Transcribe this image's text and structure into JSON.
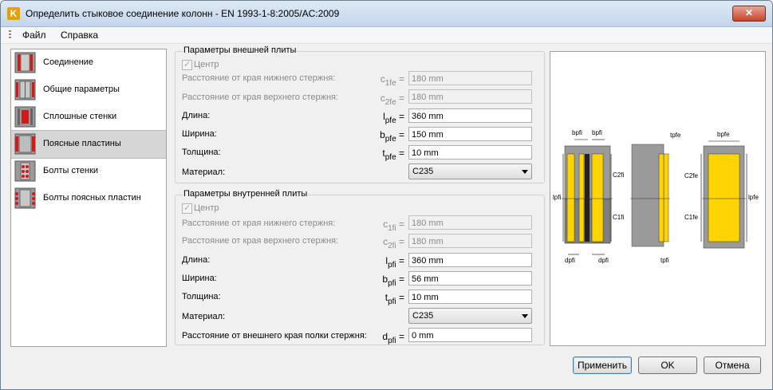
{
  "window": {
    "title": "Определить стыковое соединение колонн - EN 1993-1-8:2005/AC:2009",
    "close": "✕",
    "app_icon": "K"
  },
  "menu": [
    "Файл",
    "Справка"
  ],
  "nav": [
    {
      "label": "Соединение",
      "icon": "connection-icon"
    },
    {
      "label": "Общие параметры",
      "icon": "general-params-icon"
    },
    {
      "label": "Сплошные стенки",
      "icon": "solid-web-icon"
    },
    {
      "label": "Поясные пластины",
      "icon": "flange-plates-icon"
    },
    {
      "label": "Болты стенки",
      "icon": "web-bolts-icon"
    },
    {
      "label": "Болты поясных пластин",
      "icon": "flange-plate-bolts-icon"
    }
  ],
  "outer": {
    "title": "Параметры внешней плиты",
    "center": "Центр",
    "rows": [
      {
        "label": "Расстояние от края нижнего стержня:",
        "sym": "c",
        "sub": "1fe",
        "value": "180 mm"
      },
      {
        "label": "Расстояние от края верхнего стержня:",
        "sym": "c",
        "sub": "2fe",
        "value": "180 mm"
      },
      {
        "label": "Длина:",
        "sym": "l",
        "sub": "pfe",
        "value": "360 mm"
      },
      {
        "label": "Ширина:",
        "sym": "b",
        "sub": "pfe",
        "value": "150 mm"
      },
      {
        "label": "Толщина:",
        "sym": "t",
        "sub": "pfe",
        "value": "10 mm"
      }
    ],
    "material_label": "Материал:",
    "material": "C235"
  },
  "inner": {
    "title": "Параметры внутренней плиты",
    "center": "Центр",
    "rows": [
      {
        "label": "Расстояние от края нижнего стержня:",
        "sym": "c",
        "sub": "1fi",
        "value": "180 mm"
      },
      {
        "label": "Расстояние от края верхнего стержня:",
        "sym": "c",
        "sub": "2fi",
        "value": "180 mm"
      },
      {
        "label": "Длина:",
        "sym": "l",
        "sub": "pfi",
        "value": "360 mm"
      },
      {
        "label": "Ширина:",
        "sym": "b",
        "sub": "pfi",
        "value": "56 mm"
      },
      {
        "label": "Толщина:",
        "sym": "t",
        "sub": "pfi",
        "value": "10 mm"
      }
    ],
    "material_label": "Материал:",
    "material": "C235",
    "edge": {
      "label": "Расстояние от внешнего края полки стержня:",
      "sym": "d",
      "sub": "pfi",
      "value": "0 mm"
    }
  },
  "diagram": {
    "labels": [
      "bpfi",
      "bpfi",
      "tpfe",
      "bpfe",
      "lpfi",
      "C2fi",
      "C1fi",
      "C2fe",
      "C1fe",
      "lpfe",
      "dpfi",
      "dpfi",
      "tpfi"
    ]
  },
  "buttons": {
    "apply": "Применить",
    "ok": "OK",
    "cancel": "Отмена"
  }
}
